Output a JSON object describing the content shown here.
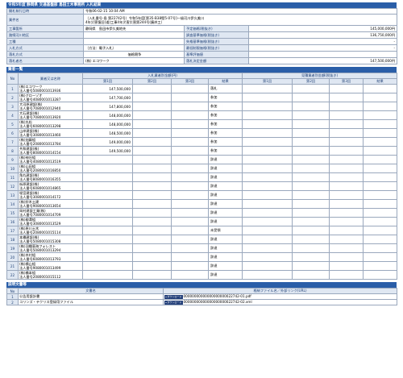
{
  "header": {
    "title": "令和5年度 静岡県 交通基盤部 島田土木事務所 入札結果"
  },
  "info": {
    "published_date_label": "開札執行日時",
    "published_date_value": "令和06-02-15 10:04 AM",
    "project_name_label": "業件名",
    "project_name_value_1": "（入札番号-島 第22742号）令和5年度[第35-B38壁5-07号]一級河川伊久美川",
    "project_name_value_2": "4年災害復旧(道)工事4年災害災害第244号(廣岸工）",
    "dept_label": "工事箇所",
    "dept_value": "静岡県　島田市伊久美地先",
    "district_label": "路線河川地区",
    "type_label": "工種",
    "method_label": "入札方式",
    "method_value": "（方法：電子入札）",
    "contract_label": "落札方式",
    "contract_value": "価格競争",
    "winner_label": "落札者名",
    "winner_value": "(株) エコワーク",
    "planned_price_label": "予定価格(税抜き)",
    "planned_price_value": "145,000,000円",
    "survey_price_label": "調査基準価格(税抜き)",
    "survey_price_value": "136,750,000円",
    "min_price_label": "失格基準価格(税抜き)",
    "min_price_value": "-",
    "lowest_limit_label": "最低制限価格(税抜き)",
    "lowest_limit_value": "-",
    "base_eval_label": "基準評価値",
    "base_eval_value": "",
    "award_price_label": "落札決定金額",
    "award_price_value": "147,500,000円"
  },
  "bidders_section": {
    "title": "業者一覧",
    "col_no": "No",
    "col_name": "業者又は名称",
    "col_bid_group": "入札業者別金額(円)",
    "col_lottery_group": "見積業者別金額(税抜き)",
    "col_round1": "第1回",
    "col_round2": "第2回",
    "col_round3": "第3回",
    "col_result": "結果",
    "rows": [
      {
        "no": "1",
        "name": "(株)エコワーク",
        "corp": "法人番号5080001013936",
        "r1": "147,500,000",
        "result": "落札"
      },
      {
        "no": "2",
        "name": "(株)グローゾオ",
        "corp": "法人番号4080001013287",
        "r1": "147,700,000",
        "result": "参加"
      },
      {
        "no": "3",
        "name": "大河原建設(株)",
        "corp": "法人番号7080001012940",
        "r1": "147,800,000",
        "result": "参加"
      },
      {
        "no": "4",
        "name": "大石建設(株)",
        "corp": "法人番号7080001013920",
        "r1": "148,000,000",
        "result": "参加"
      },
      {
        "no": "5",
        "name": "(株)丸松",
        "corp": "法人番号6080001013298",
        "r1": "148,000,000",
        "result": "参加"
      },
      {
        "no": "6",
        "name": "山岸建設(株)",
        "corp": "法人番号3080001013460",
        "r1": "148,500,000",
        "result": "参加"
      },
      {
        "no": "7",
        "name": "(株)加藤組",
        "corp": "法人番号2080001013784",
        "r1": "149,000,000",
        "result": "参加"
      },
      {
        "no": "8",
        "name": "共和建設(株)",
        "corp": "法人番号8080001014154",
        "r1": "149,500,000",
        "result": "参加"
      },
      {
        "no": "9",
        "name": "(株)神谷組",
        "corp": "法人番号4080001013519",
        "r1": "",
        "result": "辞退"
      },
      {
        "no": "10",
        "name": "(株)山田組",
        "corp": "法人番号2080001016850",
        "r1": "",
        "result": "辞退"
      },
      {
        "no": "11",
        "name": "角丸建設(株)",
        "corp": "法人番号8080001016355",
        "r1": "",
        "result": "辞退"
      },
      {
        "no": "12",
        "name": "街原建設(株)",
        "corp": "法人番号6080001014865",
        "r1": "",
        "result": "辞退"
      },
      {
        "no": "13",
        "name": "堀宮建設(株)",
        "corp": "法人番号3080001014172",
        "r1": "",
        "result": "辞退"
      },
      {
        "no": "14",
        "name": "(株)鈴木土建",
        "corp": "法人番号9080001013654",
        "r1": "",
        "result": "辞退"
      },
      {
        "no": "15",
        "name": "岡村建設工業(株)",
        "corp": "法人番号7080001014709",
        "r1": "",
        "result": "辞退"
      },
      {
        "no": "16",
        "name": "(株)柳澤組",
        "corp": "法人番号3080001013529",
        "r1": "",
        "result": "辞退"
      },
      {
        "no": "17",
        "name": "(株)原川土木",
        "corp": "法人番号2080001015114",
        "r1": "",
        "result": "未受領"
      },
      {
        "no": "18",
        "name": "本橋建設(株)",
        "corp": "法人番号5080001015308",
        "r1": "",
        "result": "辞退"
      },
      {
        "no": "19",
        "name": "(株)羽種東海フォレスト",
        "corp": "法人番号5080001013294",
        "r1": "",
        "result": "辞退"
      },
      {
        "no": "20",
        "name": "(株)木村組",
        "corp": "法人番号6080001013793",
        "r1": "",
        "result": "辞退"
      },
      {
        "no": "21",
        "name": "(株)横山組",
        "corp": "法人番号9080001013499",
        "r1": "",
        "result": "辞退"
      },
      {
        "no": "22",
        "name": "(株)橋本組",
        "corp": "法人番号2080001015112",
        "r1": "",
        "result": "辞退"
      }
    ]
  },
  "files_section": {
    "title": "説明文書等",
    "col_no": "No",
    "col_doc": "文書名",
    "col_link": "格納ファイル名／外部リンク(URL)",
    "download_label": "ダウンロード",
    "rows": [
      {
        "no": "1",
        "doc": "公告用設計書",
        "file": "00000000000000000000022742-01.pdf"
      },
      {
        "no": "2",
        "doc": "コリンズ・テクリス登録用ファイル",
        "file": "00000000000000000000022742-02.xml"
      }
    ]
  }
}
